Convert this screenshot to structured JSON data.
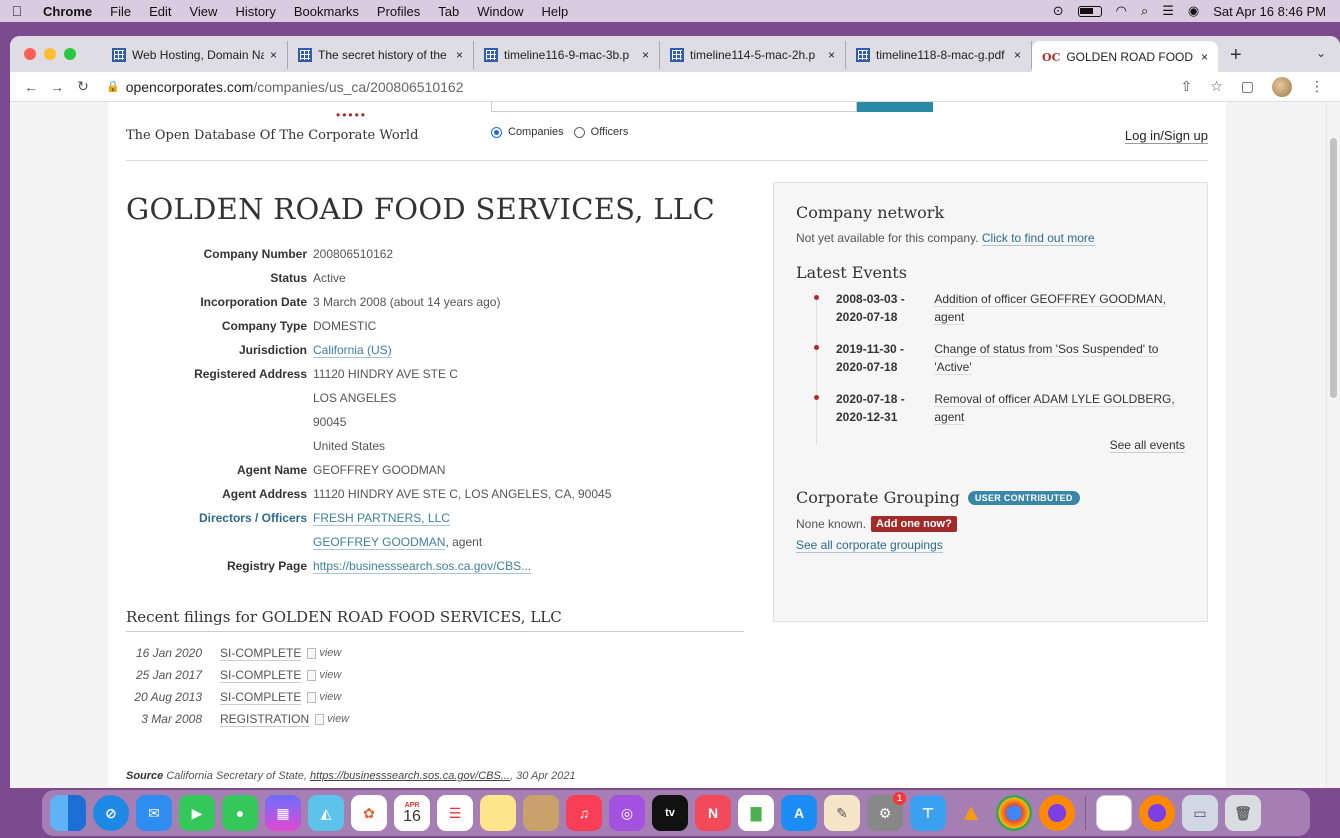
{
  "menubar": {
    "apple": "",
    "app": "Chrome",
    "items": [
      "File",
      "Edit",
      "View",
      "History",
      "Bookmarks",
      "Profiles",
      "Tab",
      "Window",
      "Help"
    ],
    "datetime": "Sat Apr 16  8:46 PM"
  },
  "tabs": [
    {
      "label": "Web Hosting, Domain Na",
      "close": "×"
    },
    {
      "label": "The secret history of the",
      "close": "×"
    },
    {
      "label": "timeline116-9-mac-3b.p",
      "close": "×"
    },
    {
      "label": "timeline114-5-mac-2h.p",
      "close": "×"
    },
    {
      "label": "timeline118-8-mac-g.pdf",
      "close": "×"
    },
    {
      "label": "GOLDEN ROAD FOOD S",
      "close": "×",
      "favicon": "OC"
    }
  ],
  "newtab": "+",
  "tabmenu": "⌄",
  "url": {
    "host": "opencorporates.com",
    "path": "/companies/us_ca/200806510162"
  },
  "header": {
    "tagline": "The Open Database Of The Corporate World",
    "radio_companies": "Companies",
    "radio_officers": "Officers",
    "login": "Log in/Sign up",
    "logo_dots": "•••••"
  },
  "company": {
    "title": "GOLDEN ROAD FOOD SERVICES, LLC",
    "attributes": {
      "number_label": "Company Number",
      "number": "200806510162",
      "status_label": "Status",
      "status": "Active",
      "inc_label": "Incorporation Date",
      "inc": "3 March 2008 (about 14 years ago)",
      "type_label": "Company Type",
      "type": "DOMESTIC",
      "jur_label": "Jurisdiction",
      "jur": "California (US)",
      "addr_label": "Registered Address",
      "addr": [
        "11120 HINDRY AVE STE C",
        "LOS ANGELES",
        "90045",
        "United States"
      ],
      "agent_label": "Agent Name",
      "agent": "GEOFFREY GOODMAN",
      "agent_addr_label": "Agent Address",
      "agent_addr": "11120 HINDRY AVE STE C, LOS ANGELES, CA, 90045",
      "officers_label": "Directors / Officers",
      "officer1": "FRESH PARTNERS, LLC",
      "officer2": "GEOFFREY GOODMAN",
      "officer2_role": ", agent",
      "registry_label": "Registry Page",
      "registry": "https://businesssearch.sos.ca.gov/CBS..."
    }
  },
  "filings": {
    "title": "Recent filings for GOLDEN ROAD FOOD SERVICES, LLC",
    "rows": [
      {
        "date": "16 Jan 2020",
        "type": "SI-COMPLETE",
        "view": "view"
      },
      {
        "date": "25 Jan 2017",
        "type": "SI-COMPLETE",
        "view": "view"
      },
      {
        "date": "20 Aug 2013",
        "type": "SI-COMPLETE",
        "view": "view"
      },
      {
        "date": "3 Mar 2008",
        "type": "REGISTRATION",
        "view": "view"
      }
    ]
  },
  "source": {
    "label": "Source",
    "text": "California Secretary of State,",
    "url": "https://businesssearch.sos.ca.gov/CBS...",
    "date": ", 30 Apr 2021"
  },
  "sidebar": {
    "network_title": "Company network",
    "network_text": "Not yet available for this company.",
    "network_link": "Click to find out more",
    "events_title": "Latest Events",
    "events": [
      {
        "d1": "2008-03-03 -",
        "d2": "2020-07-18",
        "desc": "Addition of officer GEOFFREY GOODMAN, agent"
      },
      {
        "d1": "2019-11-30 -",
        "d2": "2020-07-18",
        "desc": "Change of status from 'Sos Suspended' to 'Active'"
      },
      {
        "d1": "2020-07-18 -",
        "d2": "2020-12-31",
        "desc": "Removal of officer ADAM LYLE GOLDBERG, agent"
      }
    ],
    "see_all_events": "See all events",
    "grouping_title": "Corporate Grouping",
    "grouping_badge": "USER CONTRIBUTED",
    "none_known": "None known.",
    "add_one": "Add one now?",
    "see_groupings": "See all corporate groupings"
  },
  "dock": {
    "calendar_month": "APR",
    "calendar_day": "16",
    "tv_label": "tv",
    "badge": "1"
  },
  "colors": {
    "accent_link": "#3d7f9e",
    "brand_red": "#a8262e",
    "badge_blue": "#3a86a8"
  }
}
